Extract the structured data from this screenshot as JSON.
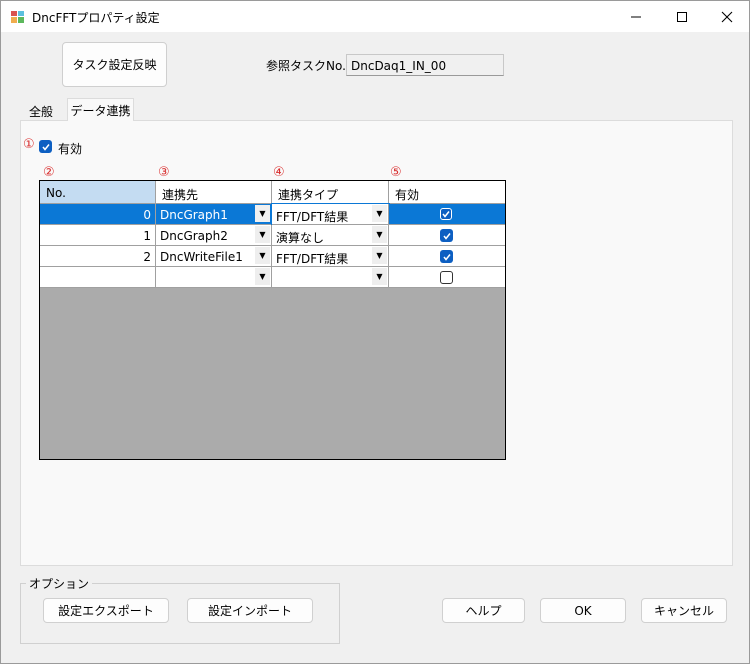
{
  "window": {
    "title": "DncFFTプロパティ設定"
  },
  "toolbar": {
    "apply_task_label": "タスク設定反映",
    "ref_task_label": "参照タスクNo.",
    "ref_task_value": "DncDaq1_IN_00"
  },
  "tabs": [
    {
      "label": "全般",
      "selected": false
    },
    {
      "label": "データ連携",
      "selected": true
    }
  ],
  "markers": [
    "①",
    "②",
    "③",
    "④",
    "⑤"
  ],
  "enable": {
    "label": "有効",
    "checked": true
  },
  "grid": {
    "columns": [
      "No.",
      "連携先",
      "連携タイプ",
      "有効"
    ],
    "rows": [
      {
        "no": "0",
        "target": "DncGraph1",
        "type": "FFT/DFT結果",
        "enabled": true,
        "selected": true
      },
      {
        "no": "1",
        "target": "DncGraph2",
        "type": "演算なし",
        "enabled": true,
        "selected": false
      },
      {
        "no": "2",
        "target": "DncWriteFile1",
        "type": "FFT/DFT結果",
        "enabled": true,
        "selected": false
      },
      {
        "no": "",
        "target": "",
        "type": "",
        "enabled": false,
        "selected": false
      }
    ]
  },
  "options": {
    "group_label": "オプション",
    "export_label": "設定エクスポート",
    "import_label": "設定インポート"
  },
  "footer": {
    "help_label": "ヘルプ",
    "ok_label": "OK",
    "cancel_label": "キャンセル"
  },
  "colors": {
    "accent": "#0d5fc2",
    "selection": "#0b78d6",
    "marker": "#d93030"
  }
}
